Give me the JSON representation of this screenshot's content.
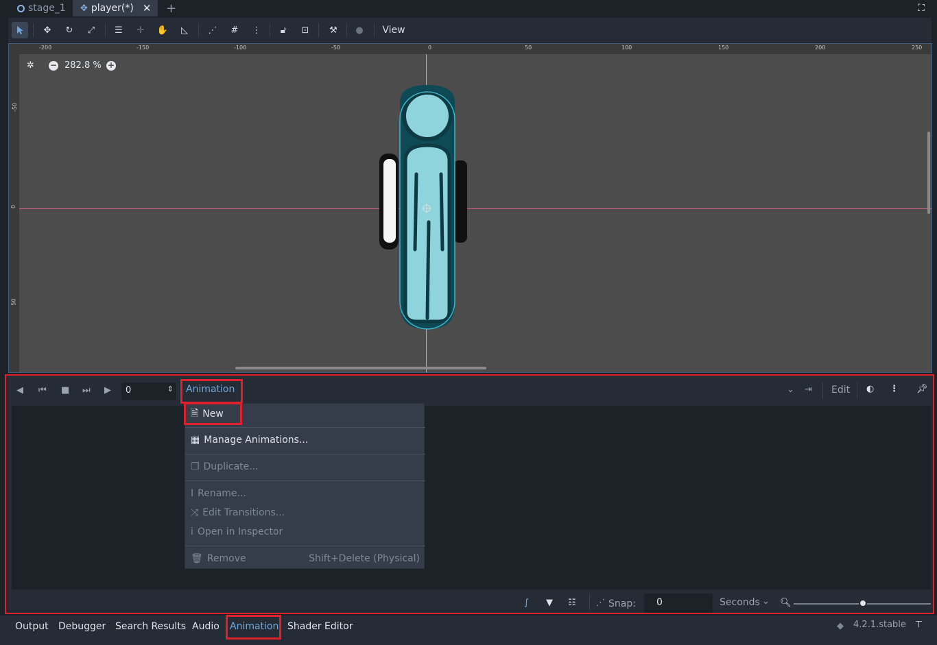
{
  "tabs": [
    {
      "label": "stage_1"
    },
    {
      "label": "player(*)"
    }
  ],
  "toolbar": {
    "view_label": "View"
  },
  "viewport": {
    "zoom": "282.8 %",
    "ruler_top": [
      "-200",
      "-150",
      "-100",
      "-50",
      "0",
      "50",
      "100",
      "150",
      "200",
      "250"
    ],
    "ruler_left": [
      "-50",
      "0",
      "50"
    ]
  },
  "animation": {
    "time_value": "0",
    "animation_menu_label": "Animation",
    "edit_label": "Edit",
    "snap_label": "Snap:",
    "snap_value": "0",
    "unit_label": "Seconds"
  },
  "menu": {
    "items": [
      {
        "label": "New",
        "enabled": true
      },
      {
        "label": "Manage Animations...",
        "enabled": true
      },
      {
        "label": "Duplicate...",
        "enabled": false
      },
      {
        "label": "Rename...",
        "enabled": false
      },
      {
        "label": "Edit Transitions...",
        "enabled": false
      },
      {
        "label": "Open in Inspector",
        "enabled": false
      },
      {
        "label": "Remove",
        "enabled": false,
        "shortcut": "Shift+Delete (Physical)"
      }
    ]
  },
  "bottom_tabs": [
    "Output",
    "Debugger",
    "Search Results",
    "Audio",
    "Animation",
    "Shader Editor"
  ],
  "version": "4.2.1.stable",
  "colors": {
    "accent": "#6fa8dc",
    "highlight": "#e0202a",
    "character": "#8fd3dd"
  }
}
